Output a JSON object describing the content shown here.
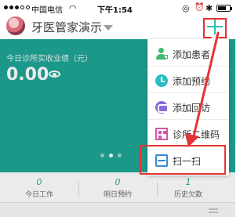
{
  "status_bar": {
    "carrier": "中国电信",
    "time": "下午1:54"
  },
  "header": {
    "clinic_name": "牙医管家演示"
  },
  "banner": {
    "label": "今日诊所实收业绩（元）",
    "amount": "0.00",
    "carousel_pages": 3,
    "active_page": 2
  },
  "stats": [
    {
      "value": "0",
      "label": "今日工作"
    },
    {
      "value": "0",
      "label": "明日预约"
    },
    {
      "value": "1",
      "label": "历史欠款"
    }
  ],
  "menu": {
    "items": [
      {
        "label": "添加患者",
        "icon": "add-patient-icon"
      },
      {
        "label": "添加预约",
        "icon": "clock-icon"
      },
      {
        "label": "添加回访",
        "icon": "followup-icon"
      },
      {
        "label": "诊所二维码",
        "icon": "qr-code-icon"
      },
      {
        "label": "扫一扫",
        "icon": "scan-icon"
      }
    ]
  },
  "colors": {
    "accent": "#1ea596",
    "highlight": "#e53333"
  }
}
